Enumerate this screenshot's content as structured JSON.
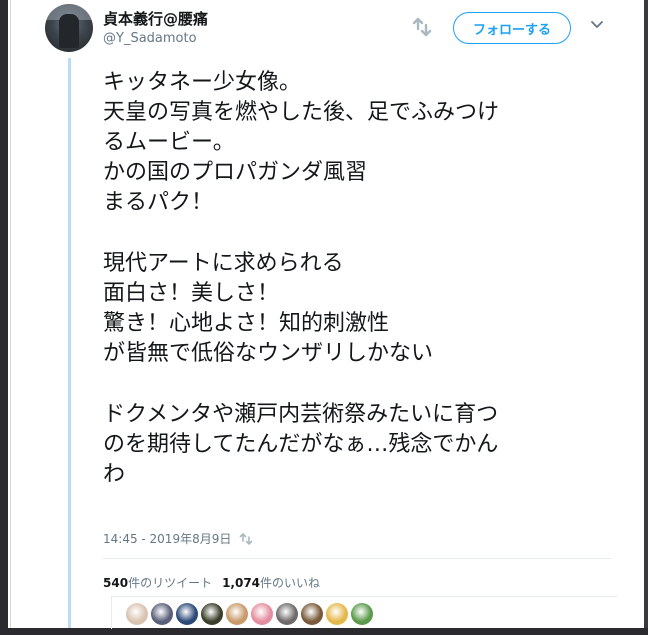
{
  "tweet": {
    "display_name": "貞本義行@腰痛",
    "handle": "@Y_Sadamoto",
    "follow_label": "フォローする",
    "lines": [
      "キッタネー少女像。",
      "天皇の写真を燃やした後、足でふみつけ",
      "るムービー。",
      "かの国のプロパガンダ風習",
      "まるパク！",
      "",
      "現代アートに求められる",
      "面白さ！美しさ！",
      "驚き！心地よさ！知的刺激性",
      "が皆無で低俗なウンザリしかない",
      "",
      "ドクメンタや瀬戸内芸術祭みたいに育つ",
      "のを期待してたんだがなぁ…残念でかん",
      "わ"
    ],
    "timestamp": "14:45 - 2019年8月9日",
    "retweet_count": "540",
    "retweet_label": "件のリツイート",
    "like_count": "1,074",
    "like_label": "件のいいね"
  },
  "icons": {
    "share": "share-icon",
    "caret": "chevron-down-icon",
    "timestamp_icon": "translate-icon"
  },
  "likers": [
    {
      "color": "#d9c3b0"
    },
    {
      "color": "#5a5f7a"
    },
    {
      "color": "#2c4a78"
    },
    {
      "color": "#3b3f2a"
    },
    {
      "color": "#c89a6a"
    },
    {
      "color": "#e58da0"
    },
    {
      "color": "#6e6a6a"
    },
    {
      "color": "#7a5a3a"
    },
    {
      "color": "#e4b84a"
    },
    {
      "color": "#5c9a4a"
    }
  ],
  "colors": {
    "accent": "#1da1f2",
    "muted": "#657786",
    "thread": "#bcdcf2"
  }
}
